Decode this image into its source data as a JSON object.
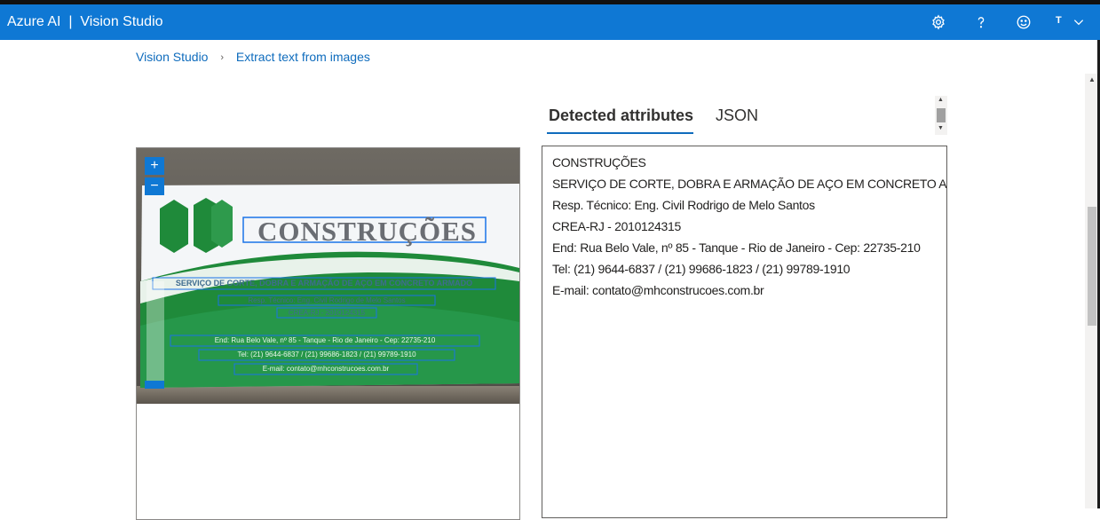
{
  "header": {
    "product": "Azure AI",
    "separator": "|",
    "app": "Vision Studio",
    "user_initial": "T",
    "icons": [
      "gear-icon",
      "help-icon",
      "feedback-smiley-icon",
      "chevron-down-icon"
    ]
  },
  "breadcrumb": {
    "home": "Vision Studio",
    "current": "Extract text from images"
  },
  "tabs": [
    {
      "label": "Detected attributes",
      "active": true
    },
    {
      "label": "JSON",
      "active": false
    }
  ],
  "image_viewer": {
    "zoom_in": "+",
    "zoom_out": "−",
    "card": {
      "brand": "CONSTRUÇÕES",
      "line1": "SERVIÇO DE CORTE, DOBRA E ARMAÇÃO DE AÇO EM CONCRETO ARMADO",
      "line2": "Resp. Técnico: Eng. Civil Rodrigo de Melo Santos",
      "line3": "CREA-RJ - 2010124315",
      "line4": "End: Rua Belo Vale, nº 85 - Tanque - Rio de Janeiro - Cep: 22735-210",
      "line5": "Tel: (21) 9644-6837 / (21) 99686-1823 / (21) 99789-1910",
      "line6": "E-mail: contato@mhconstrucoes.com.br"
    }
  },
  "results": [
    "CONSTRUÇÕES",
    "SERVIÇO DE CORTE, DOBRA E ARMAÇÃO DE AÇO EM CONCRETO ARMADO",
    "Resp. Técnico: Eng. Civil Rodrigo de Melo Santos",
    "CREA-RJ - 2010124315",
    "End: Rua Belo Vale, nº 85 - Tanque - Rio de Janeiro - Cep: 22735-210",
    "Tel: (21) 9644-6837 / (21) 99686-1823 / (21) 99789-1910",
    "E-mail: contato@mhconstrucoes.com.br"
  ],
  "colors": {
    "accent": "#0f78d4",
    "link": "#0f6cbd",
    "ocr_box": "#1a73e8",
    "card_green": "#1f8a3a"
  }
}
